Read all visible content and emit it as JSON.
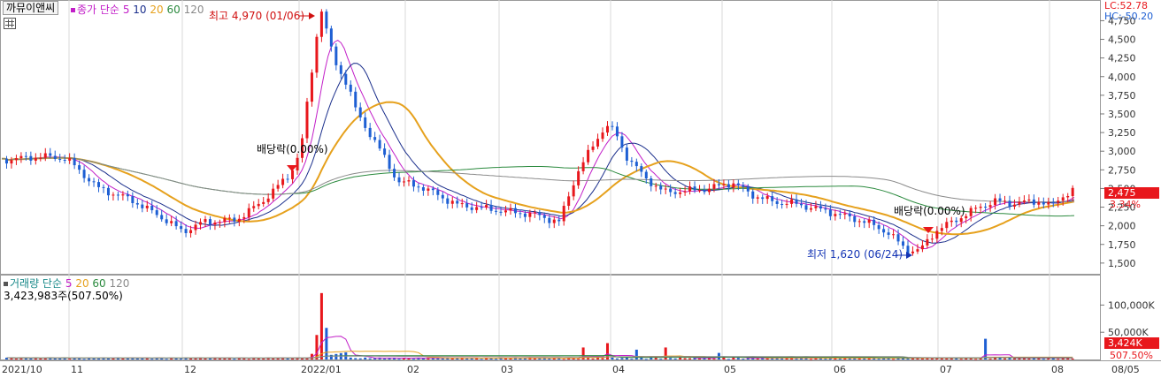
{
  "stock_name": "까뮤이앤씨",
  "price_indicator": {
    "label": "종가 단순",
    "periods": [
      "5",
      "10",
      "20",
      "60",
      "120"
    ]
  },
  "volume_indicator": {
    "label": "거래량 단순",
    "periods": [
      "5",
      "20",
      "60",
      "120"
    ]
  },
  "volume_summary": "3,423,983주(507.50%)",
  "lc_text": "LC:52.78",
  "hc_text": "HC:-50.20",
  "colors": {
    "up": "#e8171c",
    "down": "#1e5fd3",
    "ma5": "#c21ec8",
    "ma10": "#1b2f8c",
    "ma20": "#e6a11d",
    "ma60": "#2b8a3e",
    "ma120": "#8a8a8a",
    "price_tag": "#e8171c"
  },
  "annotations": {
    "high": "최고 4,970 (01/06)",
    "low": "최저 1,620 (06/24)",
    "dividend1": "배당락(0.00%)",
    "dividend2": "배당락(0.00%)"
  },
  "price_axis": {
    "min": 1380,
    "max": 4980,
    "ticks": [
      "4,750",
      "4,500",
      "4,250",
      "4,000",
      "3,750",
      "3,500",
      "3,250",
      "3,000",
      "2,750",
      "2,500",
      "2,250",
      "2,000",
      "1,750",
      "1,500"
    ]
  },
  "volume_axis": {
    "ticks": [
      "100,000K",
      "50,000K"
    ]
  },
  "current_price_tag": "2,475",
  "current_change_tag": "3.34%",
  "current_volume_tag": "3,424K",
  "current_volume_pct_tag": "507.50%",
  "date_axis": [
    "2021/10",
    "11",
    "12",
    "2022/01",
    "02",
    "03",
    "04",
    "05",
    "06",
    "07",
    "08",
    "08/05"
  ],
  "chart_data": {
    "type": "candlestick",
    "title": "까뮤이앤씨",
    "period": "2021/10 - 2022/08/05",
    "high": {
      "value": 4970,
      "date": "01/06"
    },
    "low": {
      "value": 1620,
      "date": "06/24"
    },
    "last_close": 2475,
    "last_change_pct": 3.34,
    "last_volume": "3,424K",
    "approx_close_path": [
      [
        "2021/10",
        2880
      ],
      [
        "2021/11",
        2550
      ],
      [
        "2021/12",
        2000
      ],
      [
        "2021/12 late",
        2100
      ],
      [
        "2022/01/06",
        4700
      ],
      [
        "2022/01 mid",
        3900
      ],
      [
        "2022/02",
        2500
      ],
      [
        "2022/03",
        2100
      ],
      [
        "2022/03 late",
        3300
      ],
      [
        "2022/04",
        2600
      ],
      [
        "2022/05",
        2450
      ],
      [
        "2022/06",
        2000
      ],
      [
        "2022/06/24",
        1650
      ],
      [
        "2022/07",
        2200
      ],
      [
        "2022/08",
        2475
      ]
    ],
    "moving_averages": [
      "5",
      "10",
      "20",
      "60",
      "120"
    ],
    "volume_ma": [
      "5",
      "20",
      "60",
      "120"
    ]
  }
}
